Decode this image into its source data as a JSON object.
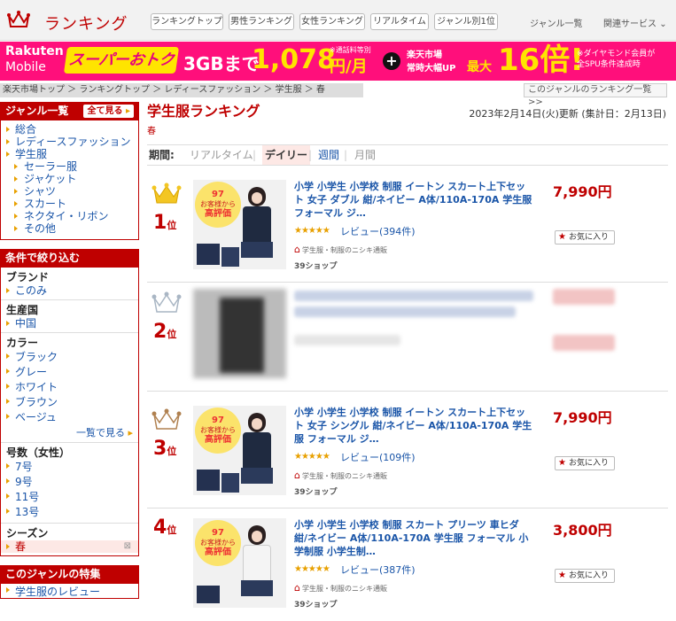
{
  "header": {
    "logo_text": "ランキング",
    "nav": [
      "ランキングトップ",
      "男性ランキング",
      "女性ランキング",
      "リアルタイム",
      "ジャンル別1位"
    ],
    "links": [
      "ジャンル一覧",
      "関連サービス"
    ]
  },
  "banner": {
    "brand1": "Rakuten",
    "brand2": "Mobile",
    "campaign": "スーパーおトク",
    "plan": "3GBまで",
    "price": "1,078",
    "unit": "円/月",
    "note1": "※通話料等別",
    "plus": "+",
    "market1": "楽天市場",
    "market2": "常時大幅UP",
    "max": "最大",
    "multiplier": "16倍!",
    "note2a": "※ダイヤモンド会員が",
    "note2b": "全SPU条件達成時"
  },
  "breadcrumb": "楽天市場トップ ＞ ランキングトップ ＞ レディースファッション ＞ 学生服 ＞ 春",
  "genre_list_link": "このジャンルのランキング一覧 >>",
  "sidebar": {
    "genre_title": "ジャンル一覧",
    "see_all": "全て見る",
    "genres": [
      "総合",
      "レディースファッション",
      "学生服"
    ],
    "sub_genres": [
      "セーラー服",
      "ジャケット",
      "シャツ",
      "スカート",
      "ネクタイ・リボン",
      "その他"
    ],
    "filter_title": "条件で絞り込む",
    "brand_title": "ブランド",
    "brand_items": [
      "このみ"
    ],
    "country_title": "生産国",
    "country_items": [
      "中国"
    ],
    "color_title": "カラー",
    "colors": [
      "ブラック",
      "グレー",
      "ホワイト",
      "ブラウン",
      "ベージュ"
    ],
    "color_more": "一覧で見る",
    "size_title": "号数（女性）",
    "sizes": [
      "7号",
      "9号",
      "11号",
      "13号"
    ],
    "season_title": "シーズン",
    "season_selected": "春",
    "feature_title": "このジャンルの特集",
    "feature_item": "学生服のレビュー"
  },
  "main": {
    "title": "学生服ランキング",
    "subcategory": "春",
    "updated": "2023年2月14日(火)更新 (集計日：2月13日)",
    "period_label": "期間:",
    "periods": [
      "リアルタイム",
      "デイリー",
      "週間",
      "月間"
    ],
    "badge_line1": "97",
    "badge_line2": "お客様から",
    "badge_line3": "高評価",
    "fav_label": "お気に入り",
    "items": [
      {
        "rank": "1",
        "rank_suffix": "位",
        "name": "小学 小学生 小学校 制服 イートン スカート上下セット 女子 ダブル 紺/ネイビー A体/110A-170A 学生服 フォーマル ジ…",
        "stars": "★★★★★",
        "review": "レビュー(394件)",
        "shop": "学生服・制服のニシキ通販",
        "points": "39ショップ",
        "price": "7,990円"
      },
      {
        "rank": "2",
        "rank_suffix": "位"
      },
      {
        "rank": "3",
        "rank_suffix": "位",
        "name": "小学 小学生 小学校 制服 イートン スカート上下セット 女子 シングル 紺/ネイビー A体/110A-170A 学生服 フォーマル ジ…",
        "stars": "★★★★★",
        "review": "レビュー(109件)",
        "shop": "学生服・制服のニシキ通販",
        "points": "39ショップ",
        "price": "7,990円"
      },
      {
        "rank": "4",
        "rank_suffix": "位",
        "name": "小学 小学生 小学校 制服 スカート プリーツ 車ヒダ 紺/ネイビー A体/110A-170A 学生服 フォーマル 小学制服 小学生制…",
        "stars": "★★★★★",
        "review": "レビュー(387件)",
        "shop": "学生服・制服のニシキ通販",
        "points": "39ショップ",
        "price": "3,800円"
      }
    ]
  },
  "colors": {
    "accent": "#bf0000",
    "banner": "#ff0f7b",
    "link": "#1a55a8",
    "gold": "#e8a000"
  }
}
